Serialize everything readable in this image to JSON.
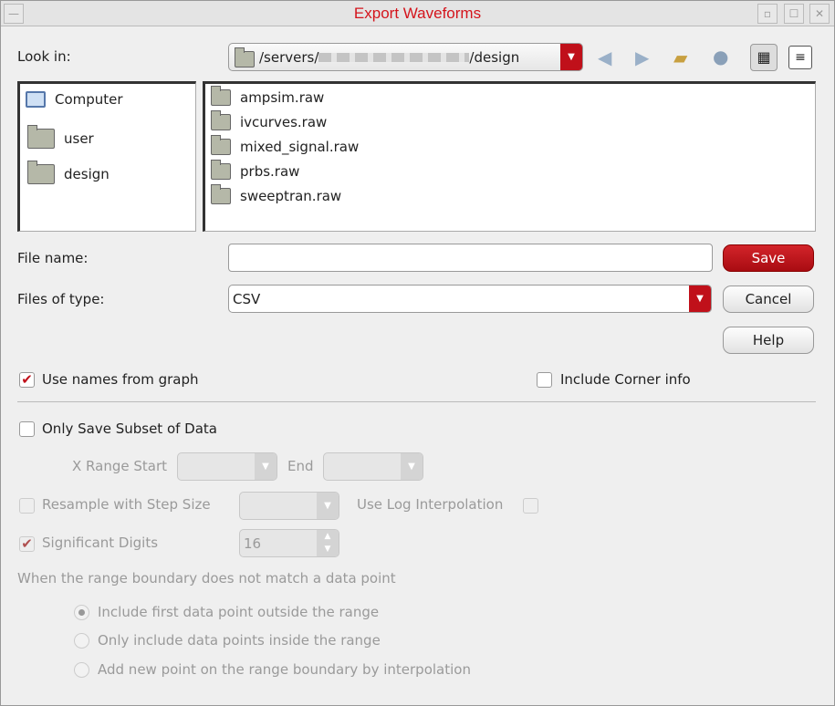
{
  "title": "Export Waveforms",
  "look_in": {
    "label": "Look in:",
    "path_prefix": "/servers/",
    "path_suffix": "/design"
  },
  "places": [
    {
      "label": "Computer",
      "icon": "computer-icon"
    },
    {
      "label": "user",
      "icon": "folder-icon"
    },
    {
      "label": "design",
      "icon": "folder-icon"
    }
  ],
  "files": [
    "ampsim.raw",
    "ivcurves.raw",
    "mixed_signal.raw",
    "prbs.raw",
    "sweeptran.raw"
  ],
  "file_name": {
    "label": "File name:",
    "value": ""
  },
  "file_type": {
    "label": "Files of type:",
    "value": "CSV"
  },
  "buttons": {
    "save": "Save",
    "cancel": "Cancel",
    "help": "Help"
  },
  "options": {
    "use_names": "Use names from graph",
    "corner_info": "Include Corner info",
    "subset": "Only Save Subset of Data",
    "x_range_start": "X Range Start",
    "end": "End",
    "resample": "Resample with Step Size",
    "log_interp": "Use Log Interpolation",
    "sig_digits": "Significant Digits",
    "sig_digits_value": "16",
    "boundary_label": "When the range boundary does not match a data point",
    "radio": [
      "Include first data point outside the range",
      "Only include data points inside the range",
      "Add new point on the range boundary by interpolation"
    ]
  },
  "colors": {
    "accent": "#c0101a",
    "title": "#d4141c"
  }
}
